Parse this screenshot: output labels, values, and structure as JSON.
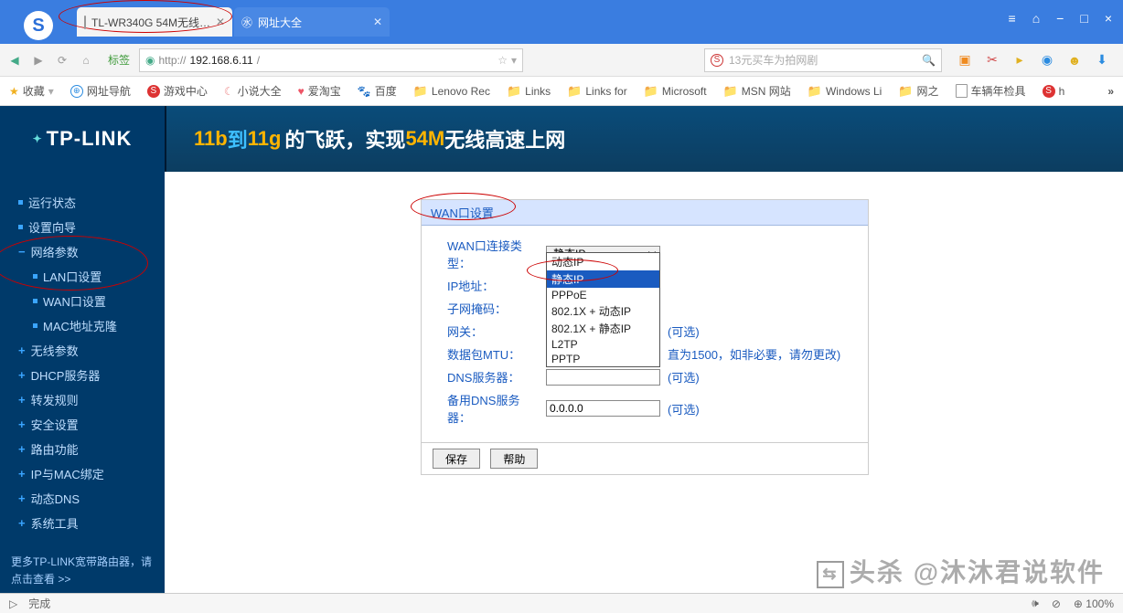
{
  "browser": {
    "tabs": [
      {
        "title": "TL-WR340G 54M无线…",
        "active": true
      },
      {
        "title": "网址大全",
        "active": false
      }
    ],
    "window_controls": [
      "≡",
      "⌂",
      "−",
      "□",
      "×"
    ],
    "nav": {
      "label": "标签"
    },
    "url_prefix": "http://",
    "url_host": "192.168.6.11",
    "url_path": "/",
    "search_placeholder": "13元买车为拍网剧",
    "bookmarks_label": "收藏",
    "bookmarks": [
      {
        "icon": "globe",
        "label": "网址导航"
      },
      {
        "icon": "red-s",
        "label": "游戏中心"
      },
      {
        "icon": "moon",
        "label": "小说大全"
      },
      {
        "icon": "heart",
        "label": "爱淘宝"
      },
      {
        "icon": "paw",
        "label": "百度"
      },
      {
        "icon": "folder",
        "label": "Lenovo Rec"
      },
      {
        "icon": "folder",
        "label": "Links"
      },
      {
        "icon": "folder",
        "label": "Links for"
      },
      {
        "icon": "folder",
        "label": "Microsoft"
      },
      {
        "icon": "folder",
        "label": "MSN 网站"
      },
      {
        "icon": "folder",
        "label": "Windows Li"
      },
      {
        "icon": "folder",
        "label": "网之"
      },
      {
        "icon": "page",
        "label": "车辆年检具"
      },
      {
        "icon": "red-s",
        "label": "h"
      }
    ]
  },
  "router": {
    "brand": "TP-LINK",
    "banner_parts": {
      "p1": "11b",
      "p2": "到",
      "p3": "11g",
      "p4": "的飞跃，实现",
      "p5": "54M",
      "p6": "无线高速上网"
    },
    "menu": {
      "items": [
        {
          "type": "leaf",
          "label": "运行状态"
        },
        {
          "type": "leaf",
          "label": "设置向导"
        },
        {
          "type": "expanded",
          "label": "网络参数",
          "children": [
            {
              "label": "LAN口设置"
            },
            {
              "label": "WAN口设置"
            },
            {
              "label": "MAC地址克隆"
            }
          ]
        },
        {
          "type": "collapsed",
          "label": "无线参数"
        },
        {
          "type": "collapsed",
          "label": "DHCP服务器"
        },
        {
          "type": "collapsed",
          "label": "转发规则"
        },
        {
          "type": "collapsed",
          "label": "安全设置"
        },
        {
          "type": "collapsed",
          "label": "路由功能"
        },
        {
          "type": "collapsed",
          "label": "IP与MAC绑定"
        },
        {
          "type": "collapsed",
          "label": "动态DNS"
        },
        {
          "type": "collapsed",
          "label": "系统工具"
        }
      ],
      "promo": "更多TP-LINK宽带路由器，请点击查看 >>"
    },
    "panel": {
      "title": "WAN口设置",
      "fields": {
        "conn_type_label": "WAN口连接类型：",
        "conn_type_value": "静态IP",
        "options": [
          "动态IP",
          "静态IP",
          "PPPoE",
          "802.1X + 动态IP",
          "802.1X + 静态IP",
          "L2TP",
          "PPTP"
        ],
        "ip_label": "IP地址：",
        "mask_label": "子网掩码：",
        "gw_label": "网关：",
        "gw_suffix": "(可选)",
        "mtu_label": "数据包MTU：",
        "mtu_suffix": "直为1500，如非必要，请勿更改)",
        "dns_label": "DNS服务器：",
        "dns_suffix": "(可选)",
        "dns2_label": "备用DNS服务器：",
        "dns2_value": "0.0.0.0",
        "dns2_suffix": "(可选)"
      },
      "buttons": {
        "save": "保存",
        "help": "帮助"
      }
    }
  },
  "statusbar": {
    "left": "完成",
    "volume": "🕪",
    "block": "⊘",
    "zoom": "100%"
  },
  "watermark": {
    "prefix": "头杀",
    "brand": "@沐沐君说软件"
  }
}
